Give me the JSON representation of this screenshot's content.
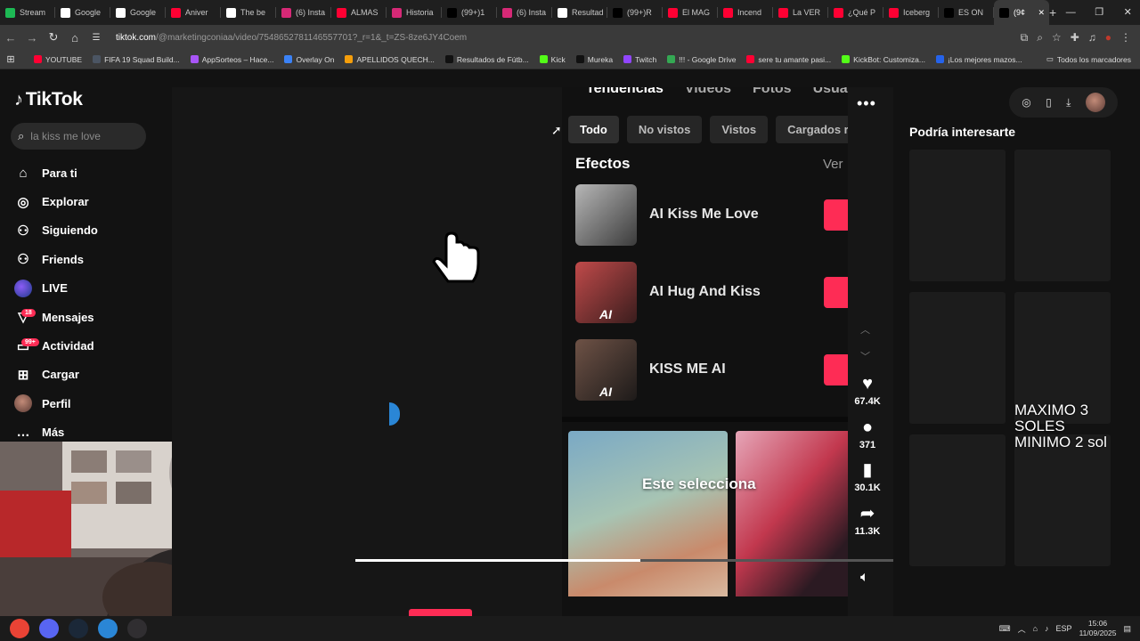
{
  "browser": {
    "tabs": [
      {
        "label": "Stream",
        "fav_color": "#1db954"
      },
      {
        "label": "Google",
        "fav_color": "#ffffff"
      },
      {
        "label": "Google",
        "fav_color": "#ffffff"
      },
      {
        "label": "Aniver",
        "fav_color": "#ff0033"
      },
      {
        "label": "The be",
        "fav_color": "#ffffff"
      },
      {
        "label": "(6) Insta",
        "fav_color": "#d62976"
      },
      {
        "label": "ALMAS",
        "fav_color": "#ff0033"
      },
      {
        "label": "Historia",
        "fav_color": "#d62976"
      },
      {
        "label": "(99+)1",
        "fav_color": "#000000"
      },
      {
        "label": "(6) Insta",
        "fav_color": "#d62976"
      },
      {
        "label": "Resultad",
        "fav_color": "#ffffff"
      },
      {
        "label": "(99+)R",
        "fav_color": "#000000"
      },
      {
        "label": "El MAG",
        "fav_color": "#ff0033"
      },
      {
        "label": "Incend",
        "fav_color": "#ff0033"
      },
      {
        "label": "La VER",
        "fav_color": "#ff0033"
      },
      {
        "label": "¿Qué P",
        "fav_color": "#ff0033"
      },
      {
        "label": "Iceberg",
        "fav_color": "#ff0033"
      },
      {
        "label": "ES ON",
        "fav_color": "#000000"
      },
      {
        "label": "(9¢",
        "fav_color": "#000000",
        "active": true
      }
    ],
    "url_host": "tiktok.com",
    "url_path": "/@marketingconiaa/video/7548652781146557701?_r=1&_t=ZS-8ze6JY4Coem",
    "bookmarks": [
      {
        "label": "YOUTUBE",
        "color": "#ff0033"
      },
      {
        "label": "FIFA 19 Squad Build...",
        "color": "#4b5563"
      },
      {
        "label": "AppSorteos – Hace...",
        "color": "#a855f7"
      },
      {
        "label": "Overlay On",
        "color": "#3b82f6"
      },
      {
        "label": "APELLIDOS QUECH...",
        "color": "#f59e0b"
      },
      {
        "label": "Resultados de Fútb...",
        "color": "#111111"
      },
      {
        "label": "Kick",
        "color": "#53fc18"
      },
      {
        "label": "Mureka",
        "color": "#111111"
      },
      {
        "label": "Twitch",
        "color": "#9146ff"
      },
      {
        "label": "!!! - Google Drive",
        "color": "#34a853"
      },
      {
        "label": "sere tu amante pasi...",
        "color": "#ff0033"
      },
      {
        "label": "KickBot: Customiza...",
        "color": "#53fc18"
      },
      {
        "label": "¡Los mejores mazos...",
        "color": "#2563eb"
      }
    ],
    "bookmarks_all": "Todos los marcadores"
  },
  "sidebar": {
    "logo": "TikTok",
    "search_placeholder": "la kiss me love",
    "items": [
      {
        "label": "Para ti",
        "icon": "home-icon",
        "glyph": "⌂"
      },
      {
        "label": "Explorar",
        "icon": "compass-icon",
        "glyph": "◎"
      },
      {
        "label": "Siguiendo",
        "icon": "following-icon",
        "glyph": "⚇"
      },
      {
        "label": "Friends",
        "icon": "friends-icon",
        "glyph": "⚇"
      },
      {
        "label": "LIVE",
        "icon": "live-avatar-icon",
        "glyph": ""
      },
      {
        "label": "Mensajes",
        "icon": "messages-icon",
        "glyph": "▽",
        "badge": "18"
      },
      {
        "label": "Actividad",
        "icon": "activity-icon",
        "glyph": "▭",
        "badge": "99+"
      },
      {
        "label": "Cargar",
        "icon": "upload-icon",
        "glyph": "⊞"
      },
      {
        "label": "Perfil",
        "icon": "profile-avatar-icon",
        "glyph": ""
      },
      {
        "label": "Más",
        "icon": "more-icon",
        "glyph": "…"
      }
    ]
  },
  "video": {
    "phone_tabs": [
      "Tendencias",
      "Videos",
      "Fotos",
      "Usuar"
    ],
    "chips": [
      "Todo",
      "No vistos",
      "Vistos",
      "Cargados r"
    ],
    "effects_title": "Efectos",
    "see_more": "Ver",
    "effects": [
      {
        "name": "AI Kiss Me Love",
        "ai_badge": ""
      },
      {
        "name": "AI Hug And Kiss",
        "ai_badge": "AI"
      },
      {
        "name": "KISS ME AI",
        "ai_badge": "AI"
      }
    ],
    "grid_caption": "Este selecciona",
    "progress": 0.53
  },
  "actions": {
    "likes": "67.4K",
    "comments": "371",
    "saves": "30.1K",
    "shares": "11.3K"
  },
  "right": {
    "title": "Podría interesarte",
    "overlay_line1": "MAXIMO 3 SOLES",
    "overlay_line2": "MINIMO 2 sol"
  },
  "taskbar": {
    "lang": "ESP",
    "time": "15:06",
    "date": "11/09/2025",
    "apps": [
      {
        "name": "chrome-icon",
        "color": "#ea4335"
      },
      {
        "name": "discord-icon",
        "color": "#5865f2"
      },
      {
        "name": "steam-icon",
        "color": "#1b2838"
      },
      {
        "name": "streamlabs-icon",
        "color": "#2a86d6"
      },
      {
        "name": "obs-icon",
        "color": "#302e31"
      }
    ]
  },
  "colors": {
    "accent": "#fe2c55",
    "bg": "#121212"
  }
}
